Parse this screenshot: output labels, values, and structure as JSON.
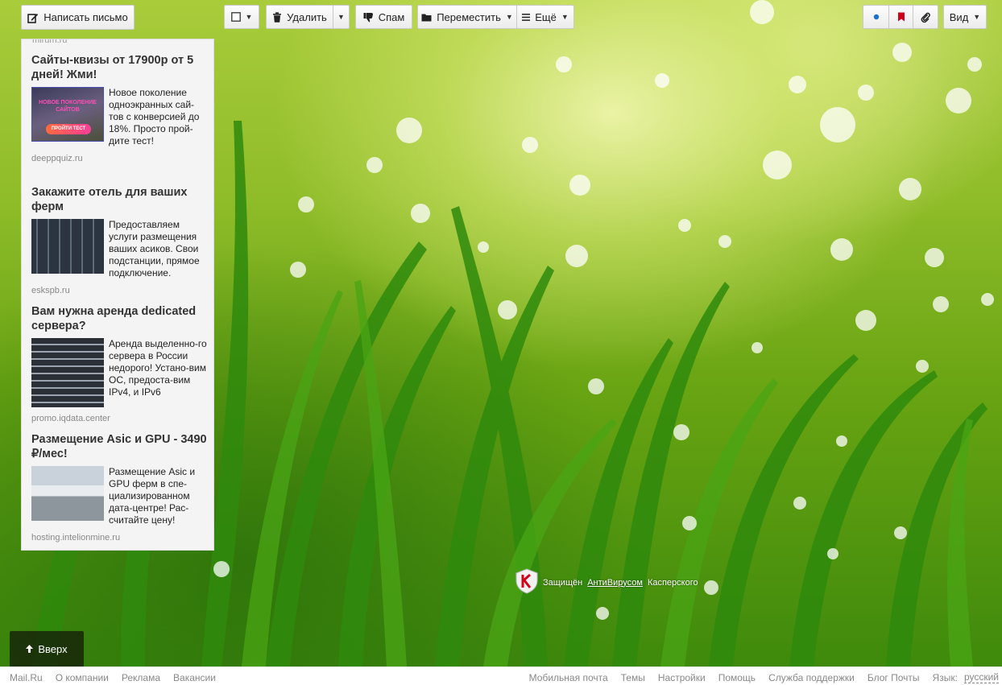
{
  "toolbar": {
    "compose_label": "Написать письмо",
    "delete_label": "Удалить",
    "spam_label": "Спам",
    "move_label": "Переместить",
    "more_label": "Ещё",
    "view_label": "Вид"
  },
  "ads": {
    "cut_domain": "mirum.ru",
    "items": [
      {
        "title": "Сайты-квизы от 17900р от 5 дней! Жми!",
        "text": "Новое поколение одноэкранных сай-тов с конверсией до 18%. Просто прой-дите тест!",
        "domain": "deeppquiz.ru",
        "thumb_line1": "НОВОЕ ПОКОЛЕНИЕ",
        "thumb_line2": "САЙТОВ",
        "thumb_button": "ПРОЙТИ ТЕСТ"
      },
      {
        "title": "Закажите отель для ваших ферм",
        "text": "Предоставляем услуги размещения ваших асиков. Свои подстанции, прямое подключение.",
        "domain": "eskspb.ru"
      },
      {
        "title": "Вам нужна аренда dedicated сервера?",
        "text": "Аренда выделенно-го сервера в России недорого! Устано-вим ОС, предоста-вим IPv4, и IPv6",
        "domain": "promo.iqdata.center"
      },
      {
        "title": "Размещение Asic и GPU - 3490 ₽/мес!",
        "text": "Размещение Asic и GPU ферм в спе-циализированном дата-центре! Рас-считайте цену!",
        "domain": "hosting.intelionmine.ru"
      }
    ]
  },
  "kaspersky": {
    "prefix": "Защищён",
    "link": "АнтиВирусом",
    "suffix": "Касперского"
  },
  "up_button": {
    "label": "Вверх"
  },
  "footer": {
    "left": [
      "Mail.Ru",
      "О компании",
      "Реклама",
      "Вакансии"
    ],
    "right": [
      "Мобильная почта",
      "Темы",
      "Настройки",
      "Помощь",
      "Служба поддержки",
      "Блог Почты"
    ],
    "lang_label": "Язык:",
    "lang_value": "русский"
  },
  "colors": {
    "flag_red": "#d0021b",
    "dot_blue": "#1a6fd6"
  }
}
